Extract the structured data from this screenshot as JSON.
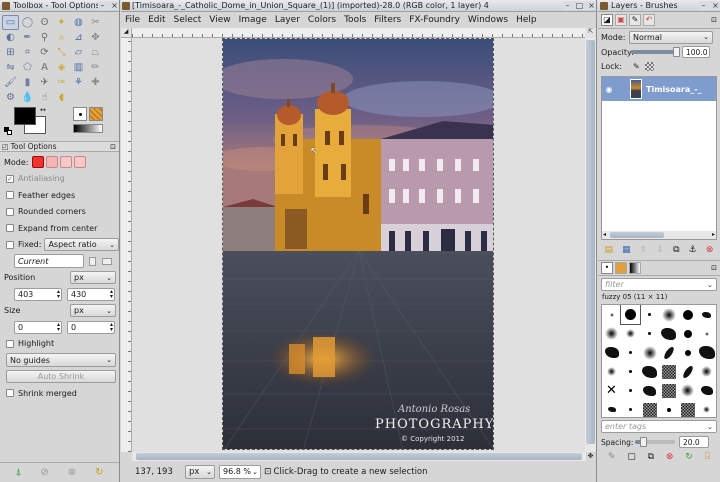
{
  "toolbox": {
    "window_title": "Toolbox - Tool Options",
    "tool_icons": [
      "rect-select-icon",
      "ellipse-select-icon",
      "free-select-icon",
      "fuzzy-select-icon",
      "color-select-icon",
      "scissors-icon",
      "foreground-select-icon",
      "paths-icon",
      "color-picker-icon",
      "zoom-icon",
      "measure-icon",
      "move-icon",
      "align-icon",
      "crop-icon",
      "rotate-icon",
      "scale-icon",
      "shear-icon",
      "perspective-icon",
      "flip-icon",
      "cage-icon",
      "text-icon",
      "bucket-fill-icon",
      "blend-icon",
      "pencil-icon",
      "paintbrush-icon",
      "eraser-icon",
      "airbrush-icon",
      "ink-icon",
      "clone-icon",
      "heal-icon",
      "perspective-clone-icon",
      "blur-icon",
      "smudge-icon",
      "dodge-burn-icon"
    ],
    "fg_color": "#000000",
    "bg_color": "#ffffff",
    "tab_label": "Tool Options",
    "mode_label": "Mode:",
    "antialiasing_label": "Antialiasing",
    "antialiasing_checked": true,
    "feather_label": "Feather edges",
    "rounded_label": "Rounded corners",
    "expand_label": "Expand from center",
    "fixed_label": "Fixed:",
    "fixed_value": "Aspect ratio",
    "current_value": "Current",
    "position_label": "Position",
    "position_unit": "px",
    "position_x": "403",
    "position_y": "430",
    "size_label": "Size",
    "size_unit": "px",
    "size_w": "0",
    "size_h": "0",
    "highlight_label": "Highlight",
    "guides_value": "No guides",
    "autoshrink_label": "Auto Shrink",
    "shrink_merged_label": "Shrink merged"
  },
  "image_window": {
    "title": "[Timisoara_-_Catholic_Dome_in_Union_Square_(1)] (imported)-28.0 (RGB color, 1 layer) 4",
    "menu": [
      "File",
      "Edit",
      "Select",
      "View",
      "Image",
      "Layer",
      "Colors",
      "Tools",
      "Filters",
      "FX-Foundry",
      "Windows",
      "Help"
    ],
    "photo": {
      "watermark_signature": "Antonio Rosas",
      "watermark_title": "PHOTOGRAPHY",
      "watermark_copyright": "© Copyright 2012"
    },
    "status": {
      "coords": "137, 193",
      "unit": "px",
      "zoom": "96.8 %",
      "message": "Click-Drag to create a new selection"
    }
  },
  "layers": {
    "window_title": "Layers - Brushes",
    "mode_label": "Mode:",
    "mode_value": "Normal",
    "opacity_label": "Opacity:",
    "opacity_value": "100.0",
    "opacity_fraction": 1.0,
    "lock_label": "Lock:",
    "layer_name": "Timisoara_-_",
    "filter_placeholder": "filter",
    "brush_name": "fuzzy 05 (11 × 11)",
    "tags_placeholder": "enter tags",
    "spacing_label": "Spacing:",
    "spacing_value": "20.0",
    "spacing_fraction": 0.2
  }
}
